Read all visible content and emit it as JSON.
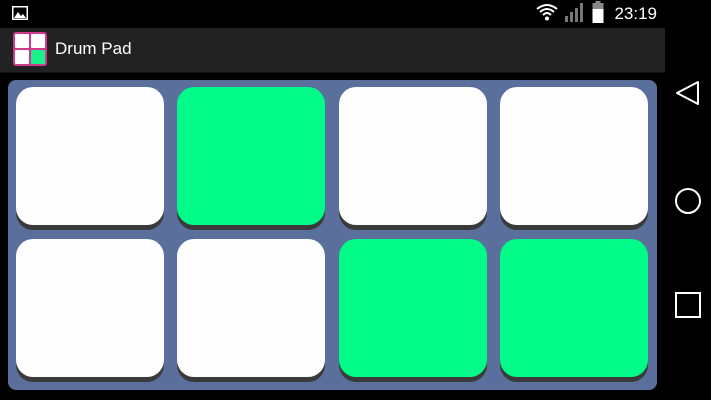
{
  "status_bar": {
    "time": "23:19",
    "icons": [
      "gallery-icon",
      "wifi-icon",
      "signal-icon",
      "battery-icon"
    ]
  },
  "app_bar": {
    "title": "Drum Pad",
    "logo": "drum-pad-app-icon"
  },
  "colors": {
    "pad_inactive": "#fdfdfd",
    "pad_active": "#02fb88",
    "pad_area_background": "#5b6f9c",
    "app_bar_background": "#222222"
  },
  "pads": [
    {
      "row": 1,
      "column": 1,
      "active": false
    },
    {
      "row": 1,
      "column": 2,
      "active": true
    },
    {
      "row": 1,
      "column": 3,
      "active": false
    },
    {
      "row": 1,
      "column": 4,
      "active": false
    },
    {
      "row": 2,
      "column": 1,
      "active": false
    },
    {
      "row": 2,
      "column": 2,
      "active": false
    },
    {
      "row": 2,
      "column": 3,
      "active": true
    },
    {
      "row": 2,
      "column": 4,
      "active": true
    }
  ],
  "nav_bar": {
    "buttons": [
      "back-icon",
      "home-icon",
      "recents-icon"
    ]
  }
}
